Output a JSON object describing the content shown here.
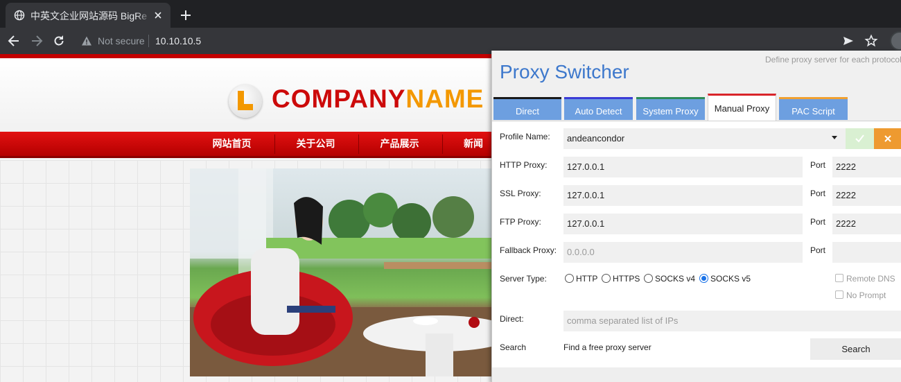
{
  "browser": {
    "tab_title": "中英文企业网站源码 BigRe",
    "url": "10.10.10.5",
    "security_label": "Not secure"
  },
  "website": {
    "logo_letter": "L",
    "logo_text_part1": "COMPANY",
    "logo_text_part2": "NAME",
    "nav_items": [
      "网站首页",
      "关于公司",
      "产品展示",
      "新闻资"
    ]
  },
  "proxy_switcher": {
    "title": "Proxy Switcher",
    "subtitle": "Define proxy server for each protocol",
    "tabs": [
      {
        "label": "Direct",
        "color": "#1a1a1a"
      },
      {
        "label": "Auto Detect",
        "color": "#3b3bd6"
      },
      {
        "label": "System Proxy",
        "color": "#2e8b57"
      },
      {
        "label": "Manual Proxy",
        "color": "#d9242a"
      },
      {
        "label": "PAC Script",
        "color": "#f0a030"
      }
    ],
    "active_tab": "Manual Proxy",
    "profile": {
      "label": "Profile Name:",
      "value": "andeancondor"
    },
    "port_label": "Port",
    "http": {
      "label": "HTTP Proxy:",
      "value": "127.0.0.1",
      "port": "2222"
    },
    "ssl": {
      "label": "SSL Proxy:",
      "value": "127.0.0.1",
      "port": "2222"
    },
    "ftp": {
      "label": "FTP Proxy:",
      "value": "127.0.0.1",
      "port": "2222"
    },
    "fallback": {
      "label": "Fallback Proxy:",
      "placeholder": "0.0.0.0",
      "port": ""
    },
    "server_type": {
      "label": "Server Type:",
      "options": [
        "HTTP",
        "HTTPS",
        "SOCKS v4",
        "SOCKS v5"
      ],
      "selected": "SOCKS v5"
    },
    "remote_dns_label": "Remote DNS",
    "no_prompt_label": "No Prompt",
    "direct": {
      "label": "Direct:",
      "placeholder": "comma separated list of IPs"
    },
    "search": {
      "label": "Search",
      "text": "Find a free proxy server",
      "button": "Search"
    }
  }
}
